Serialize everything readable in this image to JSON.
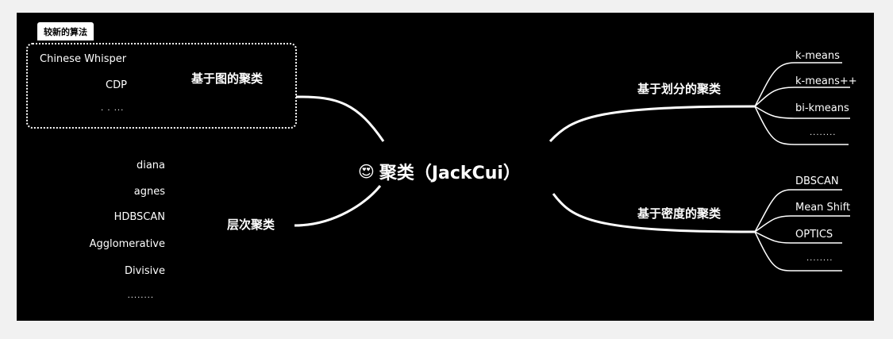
{
  "central": {
    "icon": "smiling-face-with-heart-eyes",
    "label": "聚类（JackCui）"
  },
  "left_top": {
    "tag": "较新的算法",
    "branch": "基于图的聚类",
    "leaves": [
      "Chinese Whisper",
      "CDP",
      "· · ···"
    ]
  },
  "left_bottom": {
    "branch": "层次聚类",
    "leaves": [
      "diana",
      "agnes",
      "HDBSCAN",
      "Agglomerative",
      "Divisive",
      "........"
    ]
  },
  "right_top": {
    "branch": "基于划分的聚类",
    "leaves": [
      "k-means",
      "k-means++",
      "bi-kmeans",
      "........"
    ]
  },
  "right_bottom": {
    "branch": "基于密度的聚类",
    "leaves": [
      "DBSCAN",
      "Mean Shift",
      "OPTICS",
      "........"
    ]
  },
  "colors": {
    "background": "#000000",
    "foreground": "#ffffff",
    "margin": "#f1f1f1"
  }
}
